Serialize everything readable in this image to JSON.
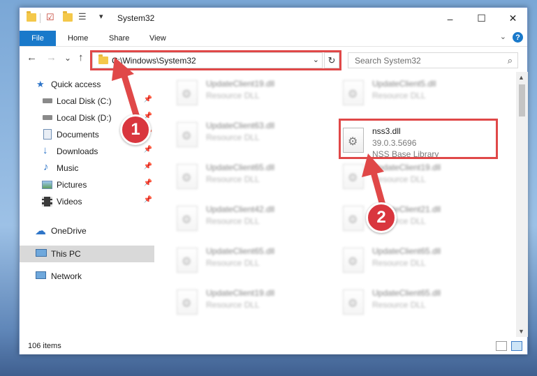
{
  "window": {
    "title": "System32",
    "controls": {
      "minimize": "–",
      "maximize": "☐",
      "close": "✕"
    }
  },
  "ribbon": {
    "file_tab": "File",
    "tabs": [
      "Home",
      "Share",
      "View"
    ],
    "help": "?"
  },
  "navigation": {
    "back": "←",
    "forward": "→",
    "recent": "⌄",
    "up": "↑",
    "address": "C:\\Windows\\System32",
    "search_placeholder": "Search System32"
  },
  "sidebar": {
    "items": [
      {
        "label": "Quick access",
        "icon": "star-icon"
      },
      {
        "label": "Local Disk (C:)",
        "icon": "drive-icon",
        "pinned": true
      },
      {
        "label": "Local Disk (D:)",
        "icon": "drive-icon",
        "pinned": true
      },
      {
        "label": "Documents",
        "icon": "documents-icon",
        "pinned": true
      },
      {
        "label": "Downloads",
        "icon": "downloads-icon",
        "pinned": true
      },
      {
        "label": "Music",
        "icon": "music-icon",
        "pinned": true
      },
      {
        "label": "Pictures",
        "icon": "pictures-icon",
        "pinned": true
      },
      {
        "label": "Videos",
        "icon": "videos-icon",
        "pinned": true
      },
      {
        "label": "OneDrive",
        "icon": "cloud-icon"
      },
      {
        "label": "This PC",
        "icon": "computer-icon",
        "selected": true
      },
      {
        "label": "Network",
        "icon": "network-icon"
      }
    ]
  },
  "files": {
    "left_column": [
      {
        "name": "UpdateClient19.dll",
        "type": "Resource DLL"
      },
      {
        "name": "UpdateClient63.dll",
        "type": "Resource DLL"
      },
      {
        "name": "UpdateClient65.dll",
        "type": "Resource DLL"
      },
      {
        "name": "UpdateClient42.dll",
        "type": "Resource DLL"
      },
      {
        "name": "UpdateClient65.dll",
        "type": "Resource DLL"
      },
      {
        "name": "UpdateClient19.dll",
        "type": "Resource DLL"
      }
    ],
    "right_column": [
      {
        "name": "UpdateClient5.dll",
        "type": "Resource DLL"
      },
      {
        "name": "nss3.dll",
        "version": "39.0.3.5696",
        "type": "NSS Base Library",
        "highlighted": true
      },
      {
        "name": "UpdateClient19.dll",
        "type": "Resource DLL"
      },
      {
        "name": "UpdateClient21.dll",
        "type": "Resource DLL"
      },
      {
        "name": "UpdateClient65.dll",
        "type": "Resource DLL"
      },
      {
        "name": "UpdateClient65.dll",
        "type": "Resource DLL"
      }
    ]
  },
  "status": {
    "item_count": "106 items"
  },
  "annotations": {
    "step1": "1",
    "step2": "2",
    "color": "#e04848"
  }
}
